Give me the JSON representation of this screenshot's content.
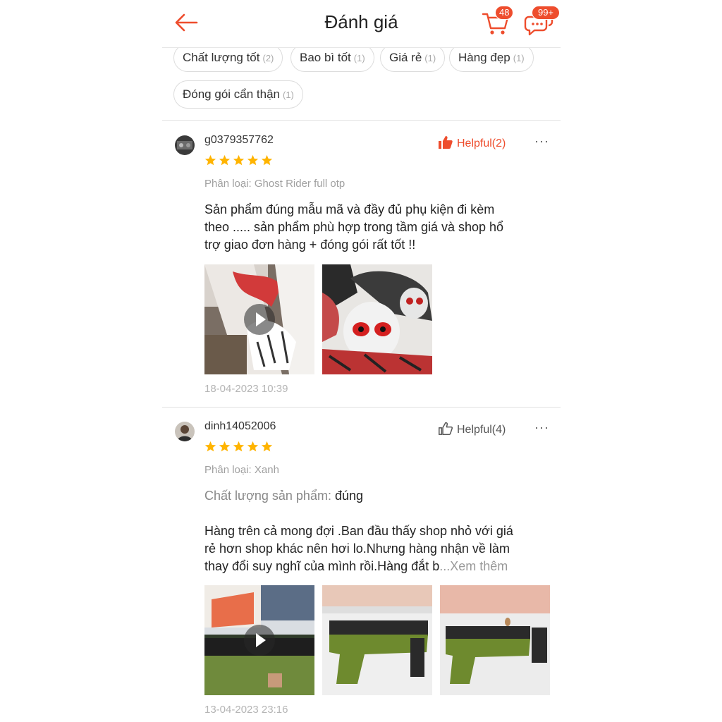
{
  "header": {
    "title": "Đánh giá",
    "cart_count": "48",
    "chat_count": "99+"
  },
  "filters": [
    {
      "label": "Chất lượng tốt",
      "count": "(2)"
    },
    {
      "label": "Bao bì tốt",
      "count": "(1)"
    },
    {
      "label": "Giá rẻ",
      "count": "(1)"
    },
    {
      "label": "Hàng đẹp",
      "count": "(1)"
    },
    {
      "label": "Đóng gói cẩn thận",
      "count": "(1)"
    }
  ],
  "reviews": [
    {
      "username": "g0379357762",
      "helpful": "Helpful(2)",
      "rating": 5,
      "variant": "Phân loại: Ghost Rider full otp",
      "lines": [
        "Sản phẩm đúng mẫu mã và đầy đủ phụ kiện đi kèm",
        "theo ..... sản phẩm phù hợp trong tầm giá và shop hổ",
        "trợ giao đơn hàng + đóng gói rất tốt !!"
      ],
      "date": "18-04-2023 10:39"
    },
    {
      "username": "dinh14052006",
      "helpful": "Helpful(4)",
      "rating": 5,
      "variant": "Phân loại: Xanh",
      "quality_label": "Chất lượng sản phẩm:",
      "quality_value": "đúng",
      "lines": [
        "Hàng trên cả mong đợi .Ban đầu thấy shop nhỏ với giá",
        "rẻ hơn shop khác nên hơi lo.Nhưng hàng nhận về làm",
        "thay đổi suy nghĩ của mình rồi.Hàng đắt b"
      ],
      "see_more": "...Xem thêm",
      "date": "13-04-2023 23:16"
    }
  ],
  "colors": {
    "accent": "#ee4d2d",
    "star": "#ffb400"
  }
}
